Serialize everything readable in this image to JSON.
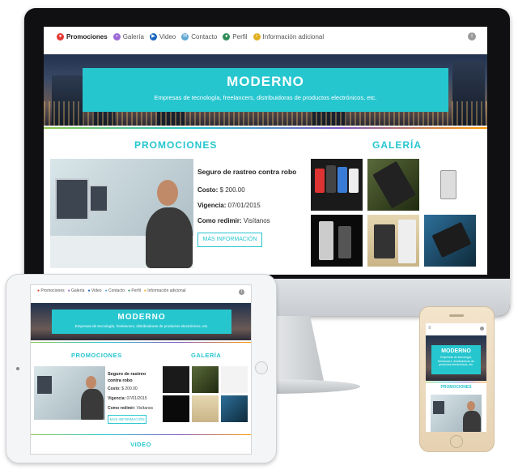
{
  "nav": {
    "items": [
      {
        "label": "Promociones",
        "icon": "tag-icon",
        "color": "#e53935",
        "active": true
      },
      {
        "label": "Galería",
        "icon": "image-icon",
        "color": "#9c6ad6"
      },
      {
        "label": "Video",
        "icon": "video-icon",
        "color": "#1565c0"
      },
      {
        "label": "Contacto",
        "icon": "mail-icon",
        "color": "#5fa8d3"
      },
      {
        "label": "Perfil",
        "icon": "user-icon",
        "color": "#2e8b57"
      },
      {
        "label": "Información adicional",
        "icon": "info-icon",
        "color": "#e0b020"
      }
    ],
    "info_icon": "info-icon"
  },
  "hero": {
    "title": "MODERNO",
    "subtitle": "Empresas de tecnología, freelancers, distribuidoras de productos electrónicos, etc.",
    "phone_subtitle": "Empresas de tecnología, freelancers, distribuidoras de productos electrónicos, etc."
  },
  "promociones": {
    "heading": "PROMOCIONES",
    "item_title": "Seguro de rastreo contra robo",
    "costo_label": "Costo:",
    "costo_value": "$ 200.00",
    "vigencia_label": "Vigencia:",
    "vigencia_value": "07/01/2015",
    "redimir_label": "Como redimir:",
    "redimir_value": "Visítanos",
    "button": "MÁS INFORMACIÓN"
  },
  "galeria": {
    "heading": "GALERÍA"
  },
  "video": {
    "heading": "VIDEO"
  },
  "colors": {
    "accent": "#26c6cf"
  }
}
